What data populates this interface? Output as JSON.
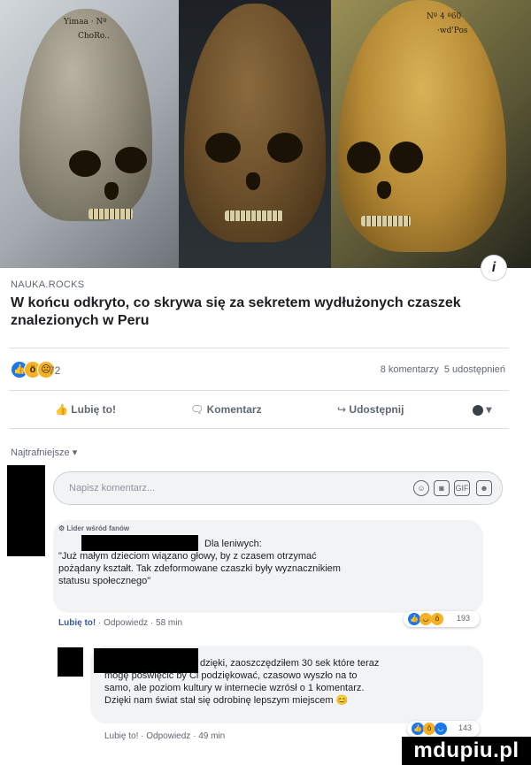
{
  "article": {
    "source": "NAUKA.ROCKS",
    "headline": "W końcu odkryto, co skrywa się za sekretem wydłużonych czaszek znalezionych w Peru",
    "info_icon": "info-icon",
    "image_icons": [
      "skull-photo-left",
      "skull-photo-center",
      "skull-photo-right"
    ]
  },
  "stats": {
    "reaction_count": "72",
    "comments": "8 komentarzy",
    "shares": "5 udostępnień",
    "reaction_icons": [
      "like-icon",
      "wow-icon",
      "sad-icon"
    ]
  },
  "actions": {
    "like": "Lubię to!",
    "comment": "Komentarz",
    "share": "Udostępnij"
  },
  "comments_section": {
    "sort_label": "Najtrafniejsze",
    "input_placeholder": "Napisz komentarz..."
  },
  "comments": [
    {
      "badge": "Lider wśród fanów",
      "lines": [
        "Dla leniwych:",
        "\"Już małym dzieciom wiązano głowy, by z czasem otrzymać",
        "pożądany kształt. Tak zdeformowane czaszki były wyznacznikiem",
        "statusu społecznego\""
      ],
      "like_action": "Lubię to!",
      "reply_action": "Odpowiedz",
      "time": "58 min",
      "reaction_count": "193"
    },
    {
      "lines": [
        "dzięki, zaoszczędziłem 30 sek które teraz",
        "mogę poświęcić by Ci podziękować, czasowo wyszło na to",
        "samo, ale poziom kultury w internecie wzrósł o 1 komentarz.",
        "Dzięki nam świat stał się odrobinę lepszym miejscem 😊"
      ],
      "like_action": "Lubię to!",
      "reply_action": "Odpowiedz",
      "time": "49 min",
      "reaction_count": "143"
    }
  ],
  "watermark": "mdupiu.pl",
  "colors": {
    "link_blue": "#385898",
    "like_blue": "#1877f2",
    "reaction_yellow": "#f7b125",
    "text_primary": "#1c1e21",
    "text_secondary": "#606770"
  }
}
